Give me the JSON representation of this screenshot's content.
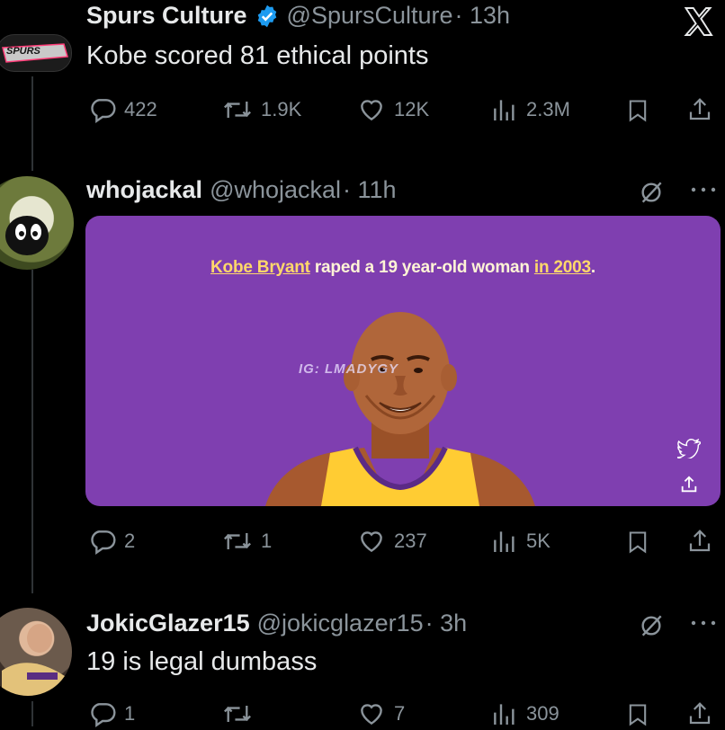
{
  "colors": {
    "background": "#000000",
    "text_primary": "#e7e9ea",
    "text_secondary": "#8b949b",
    "verified": "#1d9bf0",
    "card_purple": "#7f3fb0",
    "card_caption": "#ffd86a"
  },
  "tweets": [
    {
      "display_name": "Spurs Culture",
      "handle": "@SpursCulture",
      "time": "· 13h",
      "verified": true,
      "text": "Kobe scored 81 ethical points",
      "avatar_text": "SPURS",
      "metrics": {
        "replies": "422",
        "reposts": "1.9K",
        "likes": "12K",
        "views": "2.3M"
      }
    },
    {
      "display_name": "whojackal",
      "handle": "@whojackal",
      "time": "· 11h",
      "verified": false,
      "media": {
        "caption_part1": "Kobe Bryant",
        "caption_part2": " raped a 19 year-old woman ",
        "caption_part3": "in 2003",
        "caption_part4": ".",
        "watermark": "IG: LMADYGY"
      },
      "metrics": {
        "replies": "2",
        "reposts": "1",
        "likes": "237",
        "views": "5K"
      }
    },
    {
      "display_name": "JokicGlazer15",
      "handle": "@jokicglazer15",
      "time": "· 3h",
      "verified": false,
      "text": "19 is legal dumbass",
      "metrics": {
        "replies": "1",
        "reposts": "",
        "likes": "7",
        "views": "309"
      }
    }
  ],
  "icons": [
    "x-logo-icon",
    "verified-badge-icon",
    "reply-icon",
    "repost-icon",
    "like-icon",
    "views-icon",
    "bookmark-icon",
    "share-icon",
    "grok-icon",
    "more-icon",
    "twitter-bird-icon"
  ]
}
